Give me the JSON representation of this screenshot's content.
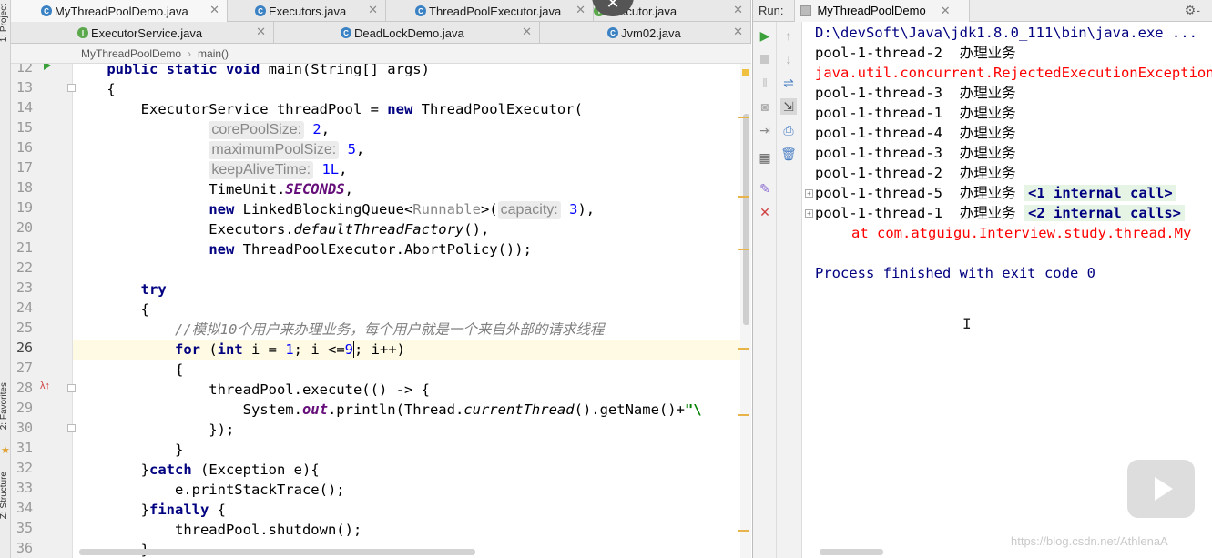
{
  "sidebar": {
    "project_label": "1: Project",
    "favorites_label": "2: Favorites",
    "structure_label": "Z: Structure"
  },
  "tabs_row1": [
    {
      "label": "MyThreadPoolDemo.java",
      "icon": "class-icon",
      "active": true
    },
    {
      "label": "Executors.java",
      "icon": "class-icon",
      "active": false
    },
    {
      "label": "ThreadPoolExecutor.java",
      "icon": "class-icon",
      "active": false
    },
    {
      "label": "Executor.java",
      "icon": "interface-icon",
      "active": false
    }
  ],
  "tabs_row2": [
    {
      "label": "ExecutorService.java",
      "icon": "interface-icon",
      "active": false
    },
    {
      "label": "DeadLockDemo.java",
      "icon": "class-icon",
      "active": false
    },
    {
      "label": "Jvm02.java",
      "icon": "class-icon",
      "active": false
    }
  ],
  "breadcrumb": [
    "MyThreadPoolDemo",
    "main()"
  ],
  "editor": {
    "line_numbers": [
      "12",
      "13",
      "14",
      "15",
      "16",
      "17",
      "18",
      "19",
      "20",
      "21",
      "22",
      "23",
      "24",
      "25",
      "26",
      "27",
      "28",
      "29",
      "30",
      "31",
      "32",
      "33",
      "34",
      "35",
      "36"
    ],
    "current_line": "26",
    "param_hints": {
      "core": "corePoolSize:",
      "max": "maximumPoolSize:",
      "keep": "keepAliveTime:",
      "capacity": "capacity:"
    },
    "comment_line": "//模拟10个用户来办理业务，每个用户就是一个来自外部的请求线程"
  },
  "run": {
    "label": "Run:",
    "config_name": "MyThreadPoolDemo",
    "console": {
      "command": "D:\\devSoft\\Java\\jdk1.8.0_111\\bin\\java.exe ...",
      "lines": [
        {
          "thread": "pool-1-thread-2",
          "msg": "办理业务"
        },
        {
          "error": "java.util.concurrent.RejectedExecutionException"
        },
        {
          "thread": "pool-1-thread-3",
          "msg": "办理业务"
        },
        {
          "thread": "pool-1-thread-1",
          "msg": "办理业务"
        },
        {
          "thread": "pool-1-thread-4",
          "msg": "办理业务"
        },
        {
          "thread": "pool-1-thread-3",
          "msg": "办理业务"
        },
        {
          "thread": "pool-1-thread-2",
          "msg": "办理业务"
        },
        {
          "thread": "pool-1-thread-5",
          "msg": "办理业务",
          "fold": "<1 internal call>"
        },
        {
          "thread": "pool-1-thread-1",
          "msg": "办理业务",
          "fold": "<2 internal calls>"
        }
      ],
      "stack_line": "at com.atguigu.Interview.study.thread.My",
      "exit_message": "Process finished with exit code 0"
    }
  },
  "watermark": "https://blog.csdn.net/AthlenaA",
  "colors": {
    "keyword": "#000080",
    "number": "#0000ff",
    "error": "#ff0000",
    "comment": "#808080"
  }
}
